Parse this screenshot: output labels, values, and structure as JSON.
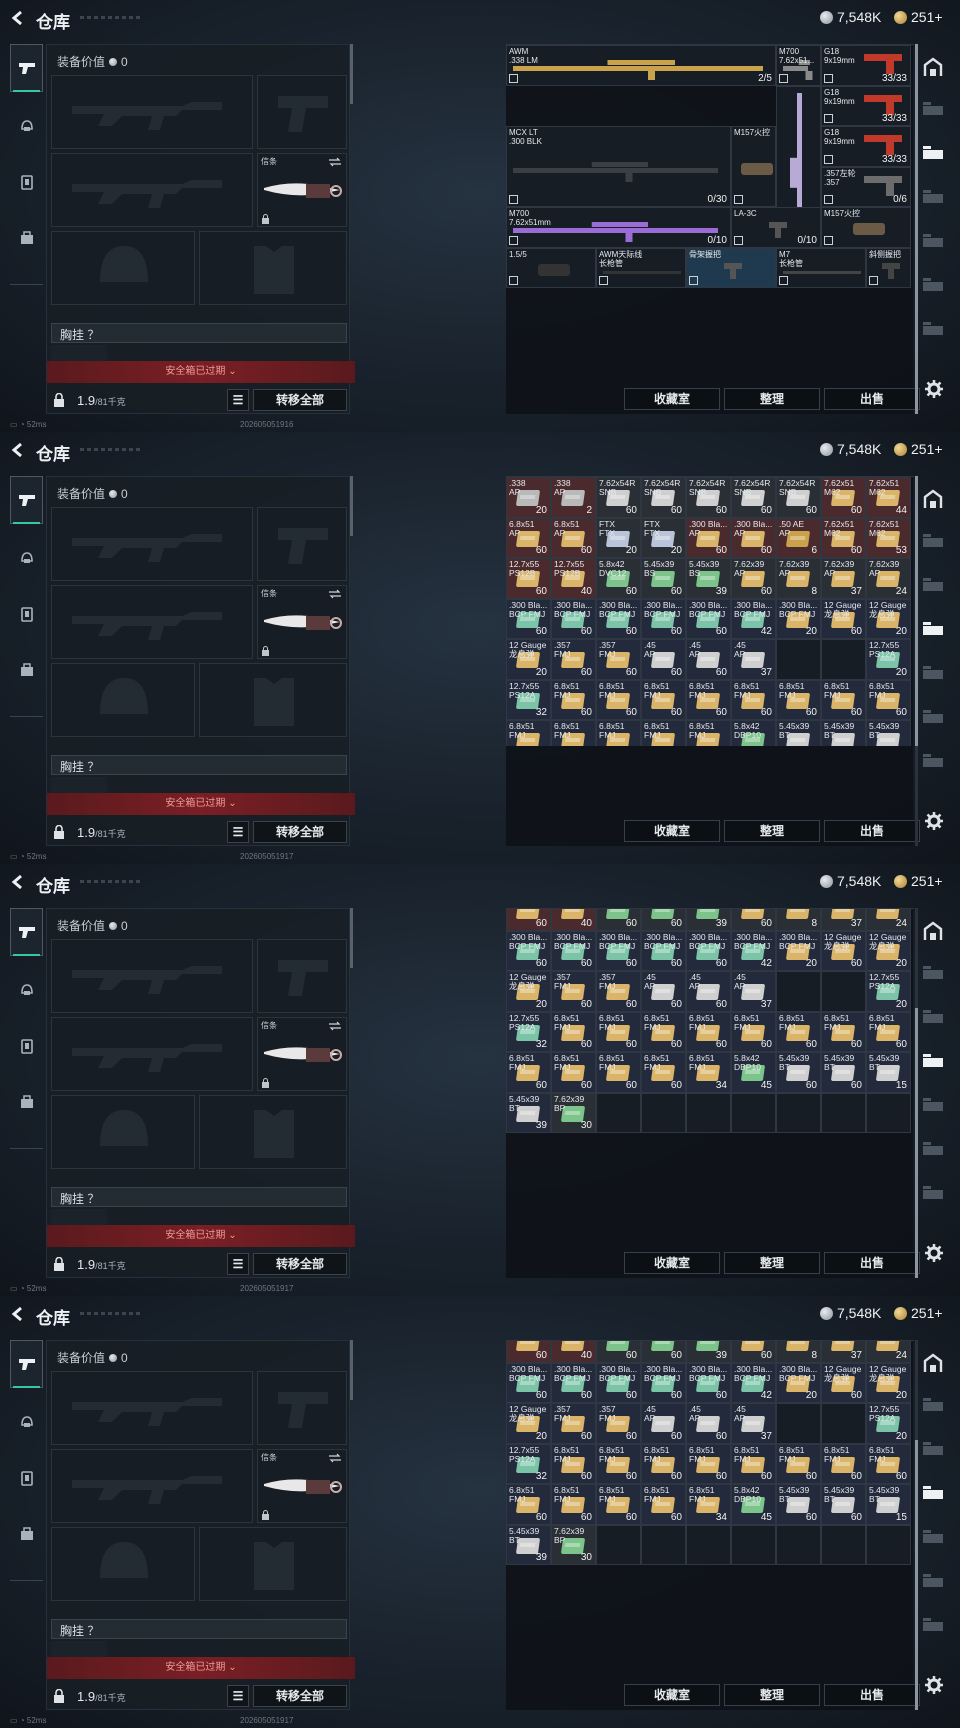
{
  "frames": [
    {
      "id": 0,
      "stamp": "202605051916",
      "view": "weapons"
    },
    {
      "id": 1,
      "stamp": "202605051917",
      "view": "ammo-top"
    },
    {
      "id": 2,
      "stamp": "202605051917",
      "view": "ammo-bottom"
    },
    {
      "id": 3,
      "stamp": "202605051917",
      "view": "ammo-bottom"
    }
  ],
  "header": {
    "title": "仓库",
    "silver": "7,548K",
    "gold": "251+"
  },
  "left": {
    "equip_value_label": "装备价值",
    "equip_value": "0",
    "melee_tag": "信条",
    "chest_label": "胸挂 ？",
    "expired": "安全箱已过期",
    "weight": "1.9",
    "weight_max": "/81千克",
    "transfer_all": "转移全部"
  },
  "status": {
    "ping": "52ms"
  },
  "buttons": {
    "collection": "收藏室",
    "organize": "整理",
    "sell": "出售"
  },
  "weapons": [
    {
      "name": "AWM\n.338 LM",
      "count": "2/5",
      "col": 0,
      "row": 0,
      "w": 6,
      "h": 1,
      "color": "#c9a24b",
      "type": "rifle"
    },
    {
      "name": "M700\n7.62x51...",
      "count": "",
      "col": 6,
      "row": 0,
      "w": 1,
      "h": 1,
      "color": "#8a8a8a",
      "type": "rifle"
    },
    {
      "name": "G18\n9x19mm",
      "count": "33/33",
      "col": 7,
      "row": 0,
      "w": 2,
      "h": 1,
      "color": "#c0392b",
      "type": "pistol"
    },
    {
      "name": "G18\n9x19mm",
      "count": "33/33",
      "col": 7,
      "row": 1,
      "w": 2,
      "h": 1,
      "color": "#c0392b",
      "type": "pistol"
    },
    {
      "name": "MCX LT\n.300 BLK",
      "count": "0/30",
      "col": 0,
      "row": 2,
      "w": 5,
      "h": 2,
      "color": "#3b3f44",
      "type": "rifle"
    },
    {
      "name": "M157火控",
      "count": "",
      "col": 5,
      "row": 2,
      "w": 1,
      "h": 2,
      "color": "#6b5a46",
      "type": "scope"
    },
    {
      "name": "",
      "count": "",
      "col": 6,
      "row": 1,
      "w": 1,
      "h": 4,
      "color": "#b9a9d6",
      "type": "vrifle"
    },
    {
      "name": "G18\n9x19mm",
      "count": "33/33",
      "col": 7,
      "row": 2,
      "w": 2,
      "h": 1,
      "color": "#c0392b",
      "type": "pistol"
    },
    {
      "name": ".357左轮\n.357",
      "count": "0/6",
      "col": 7,
      "row": 3,
      "w": 2,
      "h": 1,
      "color": "#6c6c6c",
      "type": "pistol"
    },
    {
      "name": "M700\n7.62x51mm",
      "count": "0/10",
      "col": 0,
      "row": 4,
      "w": 5,
      "h": 1,
      "color": "#9b6bd6",
      "type": "rifle"
    },
    {
      "name": "LA-3C",
      "count": "0/10",
      "col": 5,
      "row": 4,
      "w": 2,
      "h": 1,
      "color": "#555",
      "type": "small"
    },
    {
      "name": "M157火控",
      "count": "",
      "col": 7,
      "row": 4,
      "w": 2,
      "h": 1,
      "color": "#6b5a46",
      "type": "scope"
    },
    {
      "name": "1.5/5",
      "count": "",
      "col": 0,
      "row": 5,
      "w": 2,
      "h": 1,
      "color": "#333",
      "type": "scope"
    },
    {
      "name": "AWM天际线\n长枪管",
      "count": "",
      "col": 2,
      "row": 5,
      "w": 2,
      "h": 1,
      "color": "#333",
      "type": "barrel"
    },
    {
      "name": "骨架握把",
      "count": "",
      "col": 4,
      "row": 5,
      "w": 2,
      "h": 1,
      "color": "#555",
      "type": "grip",
      "hl": true
    },
    {
      "name": "M7\n长枪管",
      "count": "",
      "col": 6,
      "row": 5,
      "w": 2,
      "h": 1,
      "color": "#444",
      "type": "barrel"
    },
    {
      "name": "斜侧握把",
      "count": "",
      "col": 8,
      "row": 5,
      "w": 1,
      "h": 1,
      "color": "#444",
      "type": "grip"
    }
  ],
  "ammo": [
    [
      ".338\nAP",
      "20",
      "red",
      "#b9b9b9"
    ],
    [
      ".338\nAP",
      "2",
      "red",
      "#b9b9b9"
    ],
    [
      "7.62x54R\nSNB",
      "60",
      "def",
      "#cfcfcf"
    ],
    [
      "7.62x54R\nSNB",
      "60",
      "def",
      "#cfcfcf"
    ],
    [
      "7.62x54R\nSNB",
      "60",
      "def",
      "#cfcfcf"
    ],
    [
      "7.62x54R\nSNB",
      "60",
      "def",
      "#cfcfcf"
    ],
    [
      "7.62x54R\nSNB",
      "60",
      "def",
      "#cfcfcf"
    ],
    [
      "7.62x51\nM62",
      "60",
      "red",
      "#d9b469"
    ],
    [
      "7.62x51\nM62",
      "44",
      "red",
      "#d9b469"
    ],
    [
      "6.8x51\nAP",
      "60",
      "red",
      "#d9b469"
    ],
    [
      "6.8x51\nAP",
      "60",
      "red",
      "#d9b469"
    ],
    [
      "FTX\nFTX",
      "20",
      "def",
      "#b9c4d9"
    ],
    [
      "FTX\nFTX",
      "20",
      "def",
      "#b9c4d9"
    ],
    [
      ".300 Bla...\nAP",
      "60",
      "red",
      "#d9b469"
    ],
    [
      ".300 Bla...\nAP",
      "60",
      "red",
      "#d9b469"
    ],
    [
      ".50 AE\nAP",
      "6",
      "red",
      "#c9a24b"
    ],
    [
      "7.62x51\nM62",
      "60",
      "red",
      "#d9b469"
    ],
    [
      "7.62x51\nM62",
      "53",
      "red",
      "#d9b469"
    ],
    [
      "12.7x55\nPS12B",
      "60",
      "red",
      "#d9b469"
    ],
    [
      "12.7x55\nPS12B",
      "40",
      "red",
      "#d9b469"
    ],
    [
      "5.8x42\nDVC12",
      "60",
      "def",
      "#7cc48a"
    ],
    [
      "5.45x39\nBS",
      "60",
      "def",
      "#7cc48a"
    ],
    [
      "5.45x39\nBS",
      "39",
      "def",
      "#7cc48a"
    ],
    [
      "7.62x39\nAP",
      "60",
      "def",
      "#d9b469"
    ],
    [
      "7.62x39\nAP",
      "8",
      "def",
      "#d9b469"
    ],
    [
      "7.62x39\nAP",
      "37",
      "def",
      "#d9b469"
    ],
    [
      "7.62x39\nAP",
      "24",
      "def",
      "#d9b469"
    ],
    [
      ".300 Bla...\nBCP FMJ",
      "60",
      "blu",
      "#7cc4a8"
    ],
    [
      ".300 Bla...\nBCP FMJ",
      "60",
      "blu",
      "#7cc4a8"
    ],
    [
      ".300 Bla...\nBCP FMJ",
      "60",
      "blu",
      "#7cc4a8"
    ],
    [
      ".300 Bla...\nBCP FMJ",
      "60",
      "blu",
      "#7cc4a8"
    ],
    [
      ".300 Bla...\nBCP FMJ",
      "60",
      "blu",
      "#7cc4a8"
    ],
    [
      ".300 Bla...\nBCP FMJ",
      "42",
      "blu",
      "#7cc4a8"
    ],
    [
      ".300 Bla...\nBCP FMJ",
      "20",
      "blu",
      "#d9b469"
    ],
    [
      "12 Gauge\n龙息弹",
      "60",
      "blu",
      "#d9b469"
    ],
    [
      "12 Gauge\n龙息弹",
      "20",
      "blu",
      "#d9b469"
    ],
    [
      "12 Gauge\n龙息弹",
      "20",
      "blu",
      "#d9b469"
    ],
    [
      ".357\nFMJ",
      "60",
      "blu",
      "#d9b469"
    ],
    [
      ".357\nFMJ",
      "60",
      "blu",
      "#d9b469"
    ],
    [
      ".45\nAP",
      "60",
      "blu",
      "#cfcfcf"
    ],
    [
      ".45\nAP",
      "60",
      "blu",
      "#cfcfcf"
    ],
    [
      ".45\nAP",
      "37",
      "blu",
      "#cfcfcf"
    ],
    null,
    null,
    [
      "12.7x55\nPS12A",
      "20",
      "blu",
      "#7cc4a8"
    ],
    [
      "12.7x55\nPS12A",
      "32",
      "blu",
      "#7cc4a8"
    ],
    [
      "6.8x51\nFMJ",
      "60",
      "blu",
      "#d9b469"
    ],
    [
      "6.8x51\nFMJ",
      "60",
      "blu",
      "#d9b469"
    ],
    [
      "6.8x51\nFMJ",
      "60",
      "blu",
      "#d9b469"
    ],
    [
      "6.8x51\nFMJ",
      "60",
      "blu",
      "#d9b469"
    ],
    [
      "6.8x51\nFMJ",
      "60",
      "blu",
      "#d9b469"
    ],
    [
      "6.8x51\nFMJ",
      "60",
      "blu",
      "#d9b469"
    ],
    [
      "6.8x51\nFMJ",
      "60",
      "blu",
      "#d9b469"
    ],
    [
      "6.8x51\nFMJ",
      "60",
      "blu",
      "#d9b469"
    ],
    [
      "6.8x51\nFMJ",
      "60",
      "blu",
      "#d9b469"
    ],
    [
      "6.8x51\nFMJ",
      "60",
      "blu",
      "#d9b469"
    ],
    [
      "6.8x51\nFMJ",
      "60",
      "blu",
      "#d9b469"
    ],
    [
      "6.8x51\nFMJ",
      "60",
      "blu",
      "#d9b469"
    ],
    [
      "6.8x51\nFMJ",
      "34",
      "blu",
      "#d9b469"
    ],
    [
      "5.8x42\nDBP10",
      "45",
      "blu",
      "#7cc48a"
    ],
    [
      "5.45x39\nBT",
      "60",
      "blu",
      "#cfcfcf"
    ],
    [
      "5.45x39\nBT",
      "60",
      "blu",
      "#cfcfcf"
    ],
    [
      "5.45x39\nBT",
      "15",
      "blu",
      "#cfcfcf"
    ],
    [
      "5.45x39\nBT",
      "39",
      "blu",
      "#cfcfcf"
    ],
    [
      "7.62x39\nBP",
      "30",
      "def",
      "#7cc48a"
    ]
  ]
}
